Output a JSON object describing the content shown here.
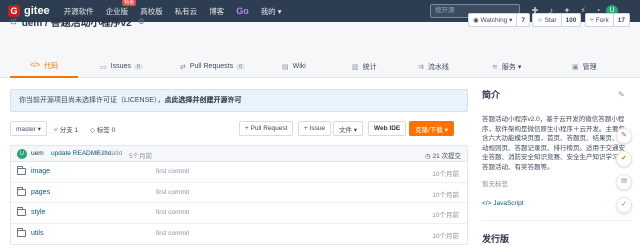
{
  "topnav": {
    "logo_mark": "G",
    "logo_text": "gitee",
    "items": [
      "开源软件",
      "企业版",
      "高校版",
      "私有云",
      "博客"
    ],
    "enterprise_badge": "特惠",
    "go_label": "Go",
    "mine_label": "我的 ▾",
    "search_placeholder": "搜开源",
    "avatar_letter": "U"
  },
  "repo": {
    "title": "uem / 答题活动小程序v2",
    "watch_label": "◉ Watching ▾",
    "watch_count": "7",
    "star_label": "☆ Star",
    "star_count": "100",
    "fork_label": "⑂ Fork",
    "fork_count": "17"
  },
  "tabs": [
    {
      "icon": "</>",
      "label": "代码",
      "badge": ""
    },
    {
      "icon": "▭",
      "label": "Issues",
      "badge": "0"
    },
    {
      "icon": "⇄",
      "label": "Pull Requests",
      "badge": "0"
    },
    {
      "icon": "▤",
      "label": "Wiki",
      "badge": ""
    },
    {
      "icon": "▥",
      "label": "统计",
      "badge": ""
    },
    {
      "icon": "⇉",
      "label": "流水线",
      "badge": ""
    },
    {
      "icon": "≋",
      "label": "服务 ▾",
      "badge": ""
    },
    {
      "icon": "▣",
      "label": "管理",
      "badge": ""
    }
  ],
  "license_notice": {
    "text": "你当前开源项目尚未选择许可证（LICENSE），",
    "link": "点此选择并创建开源许可"
  },
  "toolbar": {
    "branch": "master ▾",
    "branches": "⑂ 分支 1",
    "tags": "◇ 标签 0",
    "pull_request": "+ Pull Request",
    "issue": "+ Issue",
    "file": "文件 ▾",
    "webide": "Web IDE",
    "clone": "克隆/下载 ▾"
  },
  "commit": {
    "avatar": "U",
    "user": "uem",
    "message": "update README.md.",
    "hash": "b30ea9d",
    "time": "5个月前",
    "commits": "◷ 21 次提交"
  },
  "files": [
    {
      "name": "image",
      "message": "first commit",
      "time": "10个月前"
    },
    {
      "name": "pages",
      "message": "first commit",
      "time": "10个月前"
    },
    {
      "name": "style",
      "message": "first commit",
      "time": "10个月前"
    },
    {
      "name": "utils",
      "message": "first commit",
      "time": "10个月前"
    }
  ],
  "sidebar": {
    "intro_title": "简介",
    "description": "答题活动小程序v2.0，基于云开发的微信答题小程序，软件架构是微信原生小程序＋云开发。主要包含六大功能模块页面，首页、答题页、结果页、活动规则页、答题记录页、排行榜页。适用于交通安全答题、消防安全知识竞赛、安全生产知识学习、答题活动、有奖答题等。",
    "tags_label": "暂无标签",
    "language": "JavaScript",
    "release_title": "发行版"
  },
  "float_buttons": [
    "✎",
    "✔",
    "✉",
    "✓"
  ]
}
